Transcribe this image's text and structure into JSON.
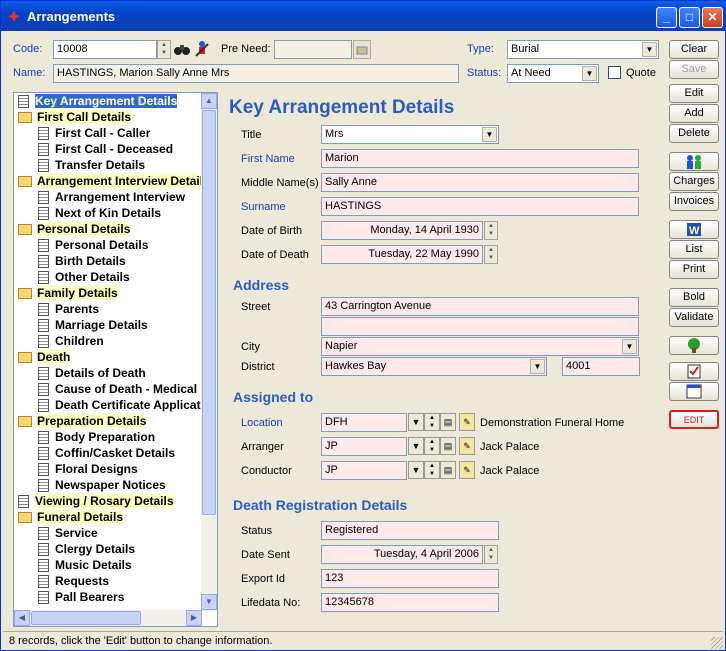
{
  "window": {
    "title": "Arrangements"
  },
  "header": {
    "code_label": "Code:",
    "code_value": "10008",
    "preneed_label": "Pre Need:",
    "preneed_value": "",
    "type_label": "Type:",
    "type_value": "Burial",
    "name_label": "Name:",
    "name_value": "HASTINGS, Marion Sally Anne Mrs",
    "status_label": "Status:",
    "status_value": "At Need",
    "quote_label": "Quote"
  },
  "toolbar": {
    "clear": "Clear",
    "save": "Save",
    "edit": "Edit",
    "add": "Add",
    "delete": "Delete",
    "charges": "Charges",
    "invoices": "Invoices",
    "list": "List",
    "print": "Print",
    "bold": "Bold",
    "validate": "Validate",
    "edit_small": "EDIT"
  },
  "tree": [
    {
      "label": "Key Arrangement Details",
      "kind": "doc",
      "level": 0,
      "selected": true
    },
    {
      "label": "First Call Details",
      "kind": "folder",
      "level": 0
    },
    {
      "label": "First Call - Caller",
      "kind": "doc",
      "level": 1
    },
    {
      "label": "First Call - Deceased",
      "kind": "doc",
      "level": 1
    },
    {
      "label": "Transfer Details",
      "kind": "doc",
      "level": 1
    },
    {
      "label": "Arrangement Interview Details",
      "kind": "folder",
      "level": 0
    },
    {
      "label": "Arrangement Interview",
      "kind": "doc",
      "level": 1
    },
    {
      "label": "Next of Kin Details",
      "kind": "doc",
      "level": 1
    },
    {
      "label": "Personal Details",
      "kind": "folder",
      "level": 0
    },
    {
      "label": "Personal Details",
      "kind": "doc",
      "level": 1
    },
    {
      "label": "Birth Details",
      "kind": "doc",
      "level": 1
    },
    {
      "label": "Other Details",
      "kind": "doc",
      "level": 1
    },
    {
      "label": "Family Details",
      "kind": "folder",
      "level": 0
    },
    {
      "label": "Parents",
      "kind": "doc",
      "level": 1
    },
    {
      "label": "Marriage Details",
      "kind": "doc",
      "level": 1
    },
    {
      "label": "Children",
      "kind": "doc",
      "level": 1
    },
    {
      "label": "Death",
      "kind": "folder",
      "level": 0
    },
    {
      "label": "Details of Death",
      "kind": "doc",
      "level": 1
    },
    {
      "label": "Cause of Death - Medical",
      "kind": "doc",
      "level": 1
    },
    {
      "label": "Death Certificate Application",
      "kind": "doc",
      "level": 1
    },
    {
      "label": "Preparation Details",
      "kind": "folder",
      "level": 0
    },
    {
      "label": "Body Preparation",
      "kind": "doc",
      "level": 1
    },
    {
      "label": "Coffin/Casket Details",
      "kind": "doc",
      "level": 1
    },
    {
      "label": "Floral Designs",
      "kind": "doc",
      "level": 1
    },
    {
      "label": "Newspaper Notices",
      "kind": "doc",
      "level": 1
    },
    {
      "label": "Viewing / Rosary Details",
      "kind": "doc",
      "level": 0
    },
    {
      "label": "Funeral Details",
      "kind": "folder",
      "level": 0
    },
    {
      "label": "Service",
      "kind": "doc",
      "level": 1
    },
    {
      "label": "Clergy Details",
      "kind": "doc",
      "level": 1
    },
    {
      "label": "Music Details",
      "kind": "doc",
      "level": 1
    },
    {
      "label": "Requests",
      "kind": "doc",
      "level": 1
    },
    {
      "label": "Pall Bearers",
      "kind": "doc",
      "level": 1
    }
  ],
  "form": {
    "heading": "Key Arrangement Details",
    "title_label": "Title",
    "title_value": "Mrs",
    "first_label": "First Name",
    "first_value": "Marion",
    "middle_label": "Middle Name(s)",
    "middle_value": "Sally Anne",
    "surname_label": "Surname",
    "surname_value": "HASTINGS",
    "dob_label": "Date of Birth",
    "dob_value": "Monday, 14 April 1930",
    "dod_label": "Date of Death",
    "dod_value": "Tuesday, 22 May 1990",
    "address_heading": "Address",
    "street_label": "Street",
    "street_value": "43 Carrington Avenue",
    "street2_value": "",
    "city_label": "City",
    "city_value": "Napier",
    "district_label": "District",
    "district_value": "Hawkes Bay",
    "postcode_value": "4001",
    "assigned_heading": "Assigned to",
    "location_label": "Location",
    "location_code": "DFH",
    "location_name": "Demonstration Funeral Home",
    "arranger_label": "Arranger",
    "arranger_code": "JP",
    "arranger_name": "Jack Palace",
    "conductor_label": "Conductor",
    "conductor_code": "JP",
    "conductor_name": "Jack Palace",
    "death_reg_heading": "Death Registration Details",
    "status_label": "Status",
    "status_value": "Registered",
    "datesent_label": "Date Sent",
    "datesent_value": "Tuesday, 4 April 2006",
    "exportid_label": "Export Id",
    "exportid_value": "123",
    "lifedata_label": "Lifedata No:",
    "lifedata_value": "12345678"
  },
  "statusbar": {
    "text": "8 records, click the 'Edit' button to change information."
  },
  "colors": {
    "titlebar": "#0842c4",
    "label_blue": "#1a3ea8",
    "heading_blue": "#2c5cbd",
    "pink_field": "#fde9ea",
    "tree_highlight": "#ffffc0",
    "selection": "#316ac5"
  }
}
